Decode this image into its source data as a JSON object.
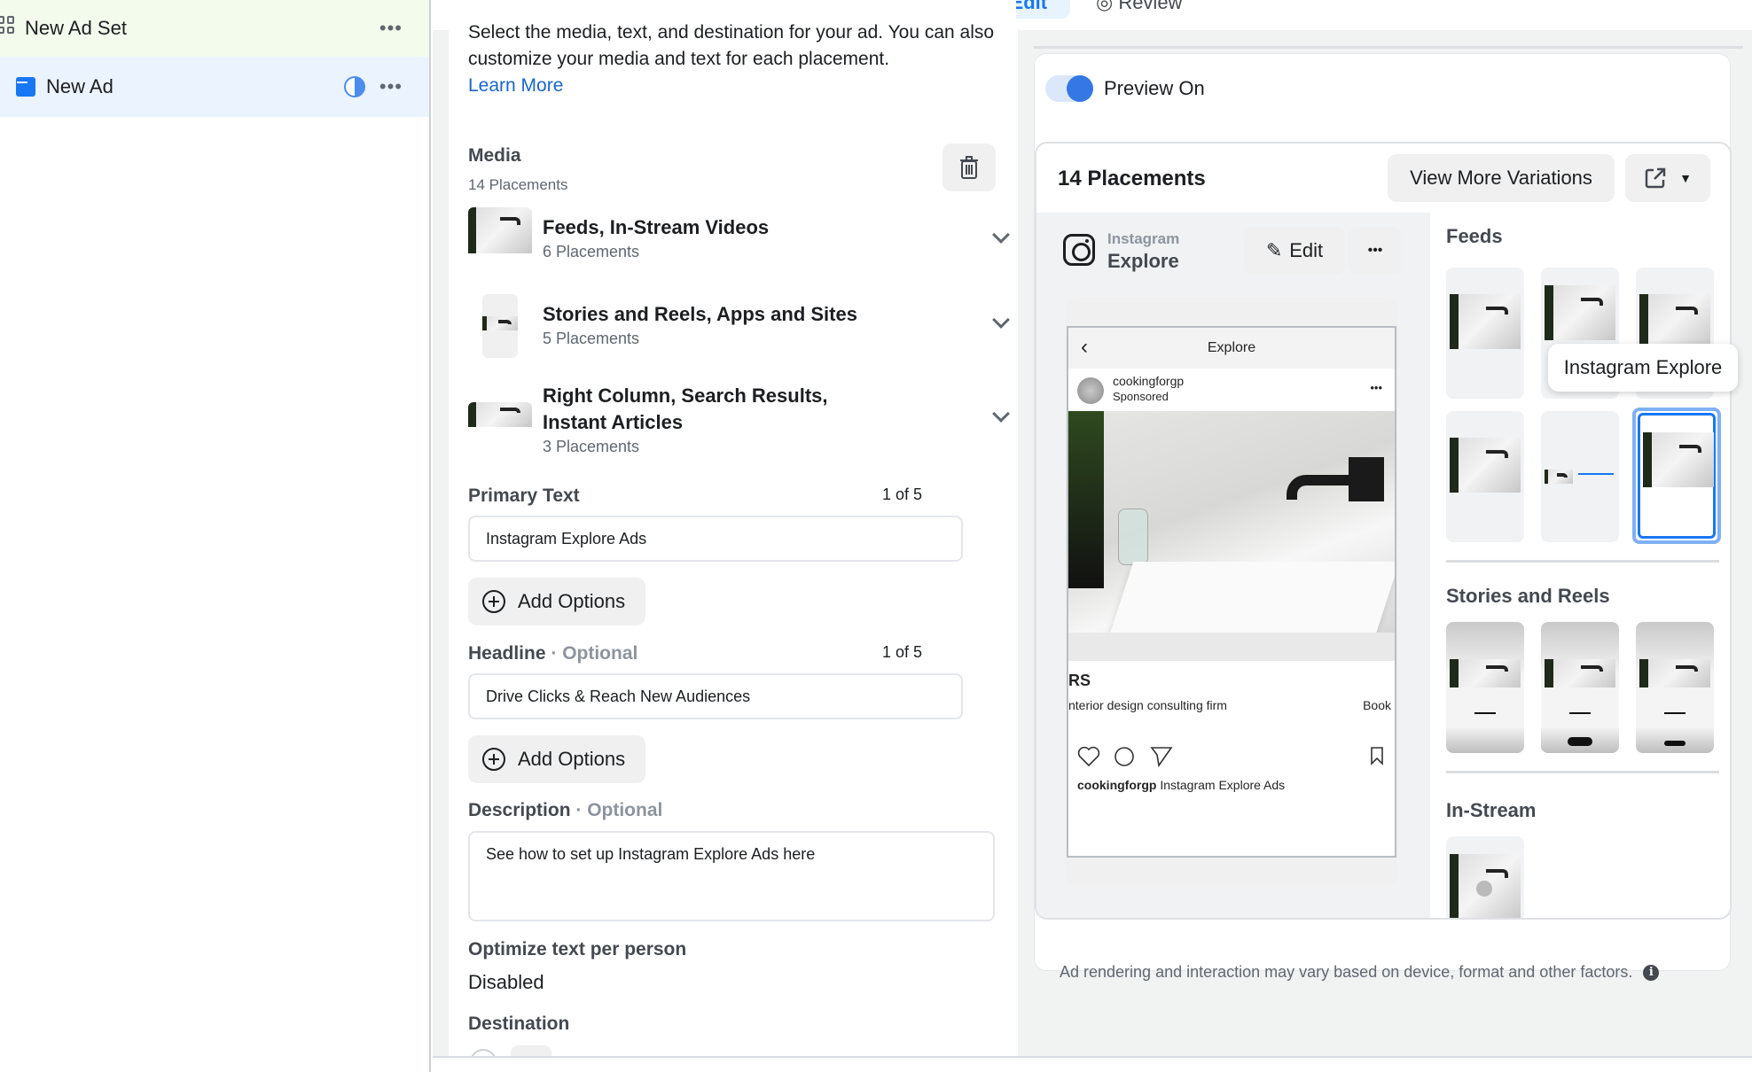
{
  "sidebar": {
    "adset_label": "New Ad Set",
    "ad_label": "New Ad",
    "more_glyph": "•••"
  },
  "tabs": {
    "edit": "Edit",
    "review": "Review"
  },
  "form": {
    "intro": "Select the media, text, and destination for your ad. You can also customize your media and text for each placement.",
    "learn_more": "Learn More",
    "media": {
      "label": "Media",
      "count": "14 Placements",
      "groups": [
        {
          "title": "Feeds, In-Stream Videos",
          "count": "6 Placements"
        },
        {
          "title": "Stories and Reels, Apps and Sites",
          "count": "5 Placements"
        },
        {
          "title": "Right Column, Search Results, Instant Articles",
          "count": "3 Placements"
        }
      ]
    },
    "primary_text": {
      "label": "Primary Text",
      "counter": "1 of 5",
      "value": "Instagram Explore Ads"
    },
    "headline": {
      "label": "Headline",
      "optional": " · Optional",
      "counter": "1 of 5",
      "value": "Drive Clicks & Reach New Audiences"
    },
    "description": {
      "label": "Description",
      "optional": " · Optional",
      "value": "See how to set up Instagram Explore Ads here"
    },
    "add_options": "Add Options",
    "optimize": {
      "label": "Optimize text per person",
      "value": "Disabled"
    },
    "destination": {
      "label": "Destination"
    }
  },
  "preview": {
    "toggle_label": "Preview On",
    "toggle_on": true,
    "placements_title": "14 Placements",
    "view_more": "View More Variations",
    "platform": "Instagram",
    "placement": "Explore",
    "edit_label": "Edit",
    "more_glyph": "•••",
    "screen_title": "Explore",
    "account": "cookingforgp",
    "sponsored": "Sponsored",
    "ad_heading": "RS",
    "ad_subtext": "nterior design consulting firm",
    "cta": "Book",
    "caption_account": "cookingforgp",
    "caption_text": "Instagram Explore Ads",
    "sections": {
      "feeds": "Feeds",
      "stories": "Stories and Reels",
      "instream": "In-Stream"
    },
    "tooltip": "Instagram Explore",
    "footnote": "Ad rendering and interaction may vary based on device, format and other factors.",
    "accent": "#1877f2"
  }
}
